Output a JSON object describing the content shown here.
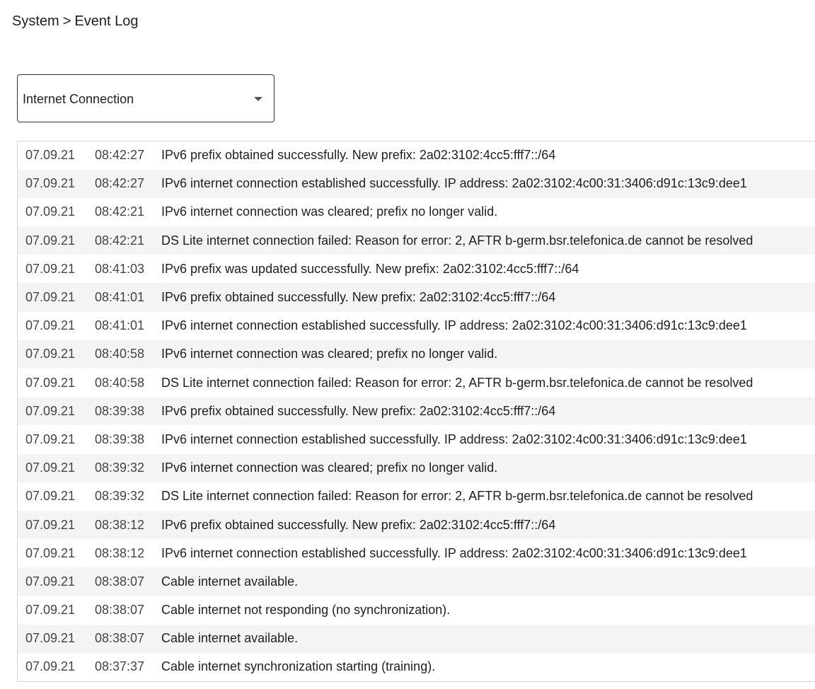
{
  "breadcrumb": {
    "parent": "System",
    "separator": ">",
    "current": "Event Log"
  },
  "filter": {
    "selected": "Internet Connection"
  },
  "log": [
    {
      "date": "07.09.21",
      "time": "08:42:27",
      "message": "IPv6 prefix obtained successfully. New prefix: 2a02:3102:4cc5:fff7::/64"
    },
    {
      "date": "07.09.21",
      "time": "08:42:27",
      "message": "IPv6 internet connection established successfully. IP address: 2a02:3102:4c00:31:3406:d91c:13c9:dee1"
    },
    {
      "date": "07.09.21",
      "time": "08:42:21",
      "message": "IPv6 internet connection was cleared; prefix no longer valid."
    },
    {
      "date": "07.09.21",
      "time": "08:42:21",
      "message": "DS Lite internet connection failed: Reason for error: 2, AFTR b-germ.bsr.telefonica.de cannot be resolved"
    },
    {
      "date": "07.09.21",
      "time": "08:41:03",
      "message": "IPv6 prefix was updated successfully. New prefix: 2a02:3102:4cc5:fff7::/64"
    },
    {
      "date": "07.09.21",
      "time": "08:41:01",
      "message": "IPv6 prefix obtained successfully. New prefix: 2a02:3102:4cc5:fff7::/64"
    },
    {
      "date": "07.09.21",
      "time": "08:41:01",
      "message": "IPv6 internet connection established successfully. IP address: 2a02:3102:4c00:31:3406:d91c:13c9:dee1"
    },
    {
      "date": "07.09.21",
      "time": "08:40:58",
      "message": "IPv6 internet connection was cleared; prefix no longer valid."
    },
    {
      "date": "07.09.21",
      "time": "08:40:58",
      "message": "DS Lite internet connection failed: Reason for error: 2, AFTR b-germ.bsr.telefonica.de cannot be resolved"
    },
    {
      "date": "07.09.21",
      "time": "08:39:38",
      "message": "IPv6 prefix obtained successfully. New prefix: 2a02:3102:4cc5:fff7::/64"
    },
    {
      "date": "07.09.21",
      "time": "08:39:38",
      "message": "IPv6 internet connection established successfully. IP address: 2a02:3102:4c00:31:3406:d91c:13c9:dee1"
    },
    {
      "date": "07.09.21",
      "time": "08:39:32",
      "message": "IPv6 internet connection was cleared; prefix no longer valid."
    },
    {
      "date": "07.09.21",
      "time": "08:39:32",
      "message": "DS Lite internet connection failed: Reason for error: 2, AFTR b-germ.bsr.telefonica.de cannot be resolved"
    },
    {
      "date": "07.09.21",
      "time": "08:38:12",
      "message": "IPv6 prefix obtained successfully. New prefix: 2a02:3102:4cc5:fff7::/64"
    },
    {
      "date": "07.09.21",
      "time": "08:38:12",
      "message": "IPv6 internet connection established successfully. IP address: 2a02:3102:4c00:31:3406:d91c:13c9:dee1"
    },
    {
      "date": "07.09.21",
      "time": "08:38:07",
      "message": "Cable internet available."
    },
    {
      "date": "07.09.21",
      "time": "08:38:07",
      "message": "Cable internet not responding (no synchronization)."
    },
    {
      "date": "07.09.21",
      "time": "08:38:07",
      "message": "Cable internet available."
    },
    {
      "date": "07.09.21",
      "time": "08:37:37",
      "message": "Cable internet synchronization starting (training)."
    }
  ]
}
